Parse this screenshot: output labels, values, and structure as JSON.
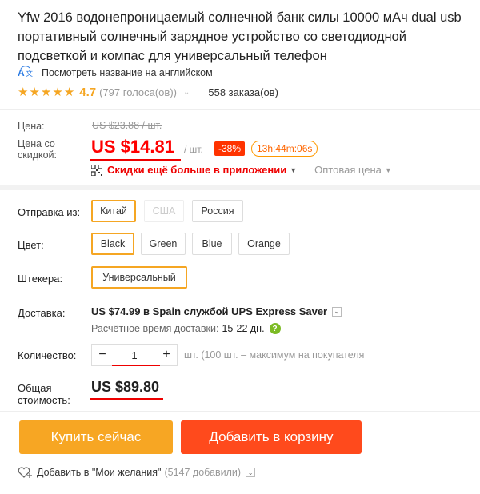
{
  "product": {
    "title": "Yfw 2016 водонепроницаемый солнечной банк силы 10000 мАч dual usb портативный солнечный зарядное устройство со светодиодной подсветкой и компас для универсальный телефон",
    "translate_link": "Посмотреть название на английском",
    "translate_icon": "translate-icon"
  },
  "rating": {
    "stars": 5,
    "score": "4.7",
    "votes": "(797 голоса(ов))",
    "orders": "558 заказа(ов)"
  },
  "price": {
    "label_price": "Цена:",
    "old_price": "US $23.88 / шт.",
    "label_discount_line1": "Цена со",
    "label_discount_line2": "скидкой:",
    "new_price": "US $14.81",
    "per_unit": "/ шт.",
    "discount_badge": "-38%",
    "timer": "13h:44m:06s",
    "app_discount": "Скидки ещё больше в приложении",
    "wholesale": "Оптовая цена"
  },
  "options": {
    "ship_from_label": "Отправка из:",
    "ship_from": [
      "Китай",
      "США",
      "Россия"
    ],
    "color_label": "Цвет:",
    "colors": [
      "Black",
      "Green",
      "Blue",
      "Orange"
    ],
    "plug_label": "Штекера:",
    "plug": [
      "Универсальный"
    ]
  },
  "shipping": {
    "label": "Доставка:",
    "method": "US $74.99 в Spain службой UPS Express Saver",
    "estimate_label": "Расчётное время доставки:",
    "estimate_days": "15-22 дн."
  },
  "quantity": {
    "label": "Количество:",
    "minus": "−",
    "value": "1",
    "plus": "+",
    "note": "шт. (100 шт. – максимум на покупателя"
  },
  "total": {
    "label_line1": "Общая",
    "label_line2": "стоимость:",
    "value": "US $89.80"
  },
  "actions": {
    "buy_now": "Купить сейчас",
    "add_to_cart": "Добавить в корзину"
  },
  "wishlist": {
    "label": "Добавить в \"Мои желания\"",
    "count": "(5147 добавили)"
  },
  "colors_theme": {
    "accent_orange": "#f7a623",
    "cart_red": "#ff4a1c",
    "price_red": "#ff0000",
    "star": "#f5a623"
  }
}
